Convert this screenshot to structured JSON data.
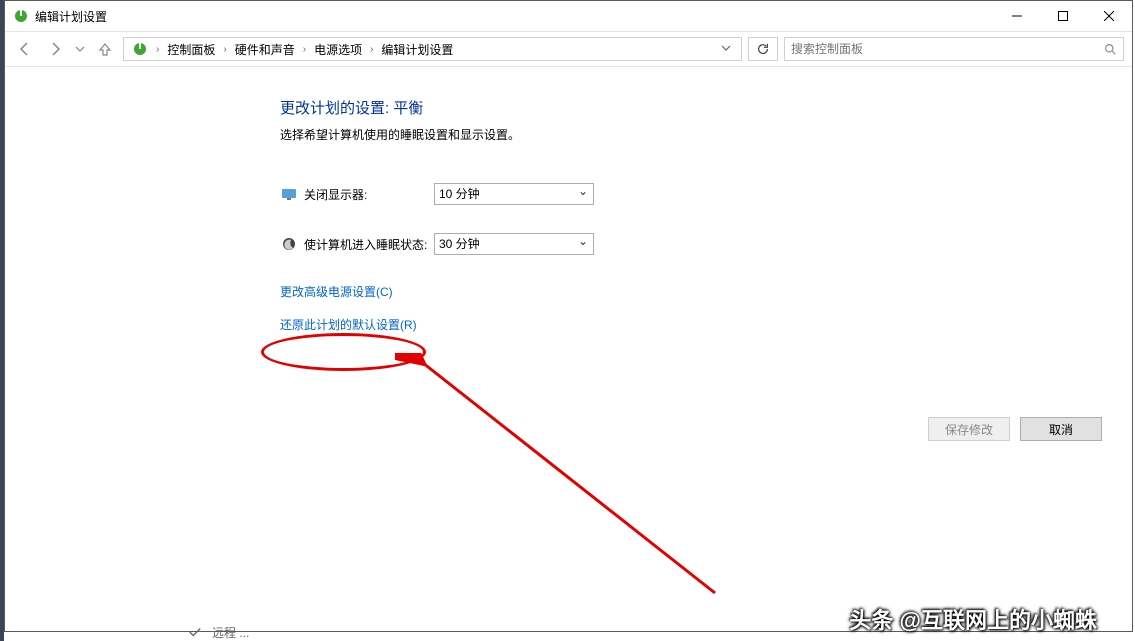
{
  "window": {
    "title": "编辑计划设置"
  },
  "breadcrumb": {
    "items": [
      "控制面板",
      "硬件和声音",
      "电源选项",
      "编辑计划设置"
    ]
  },
  "search": {
    "placeholder": "搜索控制面板"
  },
  "main": {
    "heading": "更改计划的设置: 平衡",
    "subtext": "选择希望计算机使用的睡眠设置和显示设置。",
    "settings": [
      {
        "label": "关闭显示器:",
        "value": "10 分钟"
      },
      {
        "label": "使计算机进入睡眠状态:",
        "value": "30 分钟"
      }
    ],
    "links": {
      "advanced": "更改高级电源设置(C)",
      "restore": "还原此计划的默认设置(R)"
    },
    "buttons": {
      "save": "保存修改",
      "cancel": "取消"
    }
  },
  "watermark": "头条 @互联网上的小蜘蛛",
  "bottom_fragment": "远程 ..."
}
